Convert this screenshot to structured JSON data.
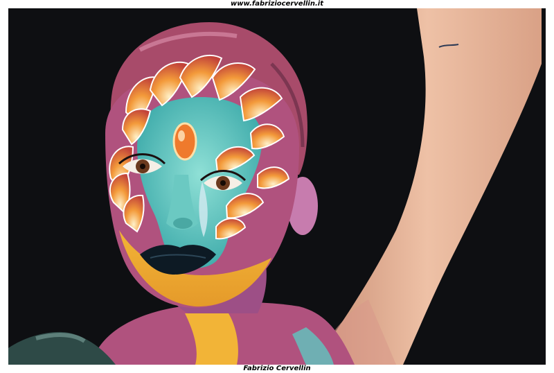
{
  "header": {
    "url": "www.fabriziocervellin.it"
  },
  "footer": {
    "credit": "Fabrizio Cervellin"
  },
  "photo": {
    "subject": "body-painted-face-portrait",
    "colors": {
      "background": "#0e0f12",
      "skin": "#e8b49a",
      "teal": "#5fc7c0",
      "magenta": "#b0527e",
      "orange": "#ef7a2c",
      "yellow": "#f2b437",
      "lips": "#0d1a24"
    }
  }
}
